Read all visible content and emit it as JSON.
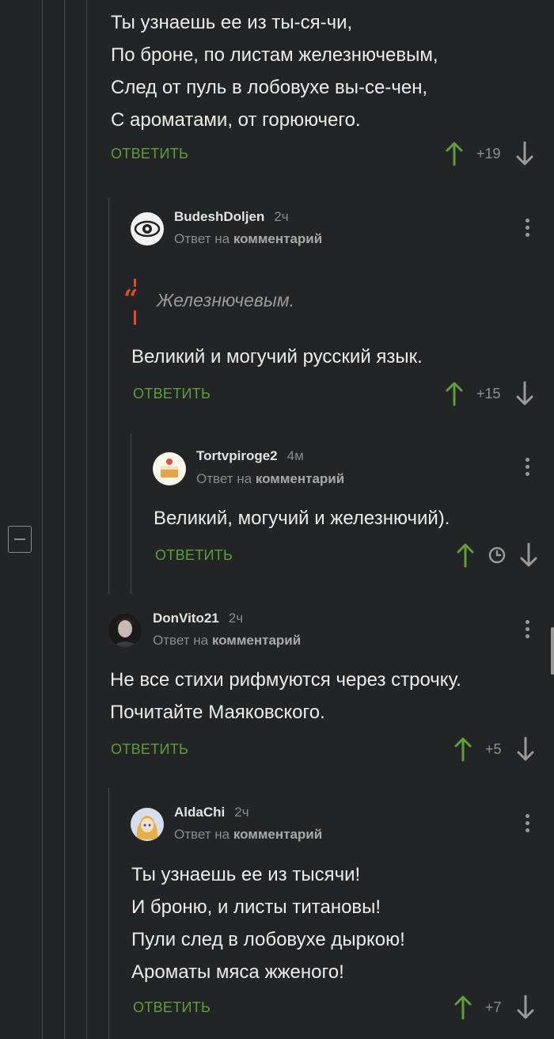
{
  "colors": {
    "background": "#232425",
    "accent_green": "#5f9e3a",
    "quote_red": "#e4492a"
  },
  "root_comment": {
    "lines": [
      "Ты узнаешь ее из ты-ся-чи,",
      "По броне, по листам железнючевым,",
      "След от пуль в лобовухе вы-се-чен,",
      "С ароматами, от горюючего."
    ],
    "reply_label": "ОТВЕТИТЬ",
    "score": "+19"
  },
  "comment_budesh": {
    "author": "BudeshDoljen",
    "time": "2ч",
    "meta_prefix": "Ответ на",
    "meta_link": "комментарий",
    "quote": "Железнючевым.",
    "text": "Великий и могучий русский язык.",
    "reply_label": "ОТВЕТИТЬ",
    "score": "+15"
  },
  "comment_tort": {
    "author": "Tortvpiroge2",
    "time": "4м",
    "meta_prefix": "Ответ на",
    "meta_link": "комментарий",
    "text": "Великий, могучий и железнючий).",
    "reply_label": "ОТВЕТИТЬ",
    "score_icon": "clock-icon"
  },
  "comment_donvito": {
    "author": "DonVito21",
    "time": "2ч",
    "meta_prefix": "Ответ на",
    "meta_link": "комментарий",
    "lines": [
      "Не все стихи рифмуются через строчку.",
      "Почитайте Маяковского."
    ],
    "reply_label": "ОТВЕТИТЬ",
    "score": "+5"
  },
  "comment_aldachi": {
    "author": "AldaChi",
    "time": "2ч",
    "meta_prefix": "Ответ на",
    "meta_link": "комментарий",
    "lines": [
      "Ты узнаешь ее из тысячи!",
      "И броню, и листы титановы!",
      "Пули след в лобовухе дыркою!",
      "Ароматы мяса жженого!"
    ],
    "reply_label": "ОТВЕТИТЬ",
    "score": "+7"
  }
}
